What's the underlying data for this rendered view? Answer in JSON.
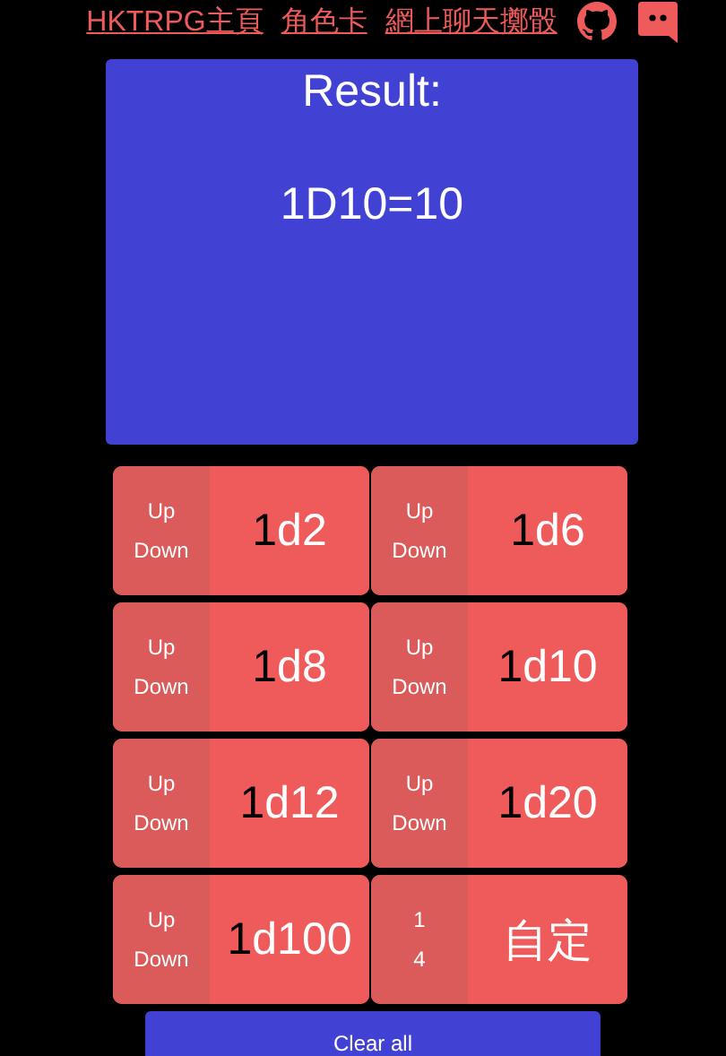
{
  "nav": {
    "links": [
      "HKTRPG主頁",
      "角色卡",
      "網上聊天擲骰"
    ]
  },
  "result": {
    "title": "Result:",
    "text": "1D10=10"
  },
  "dice": [
    {
      "kind": "updown",
      "up": "Up",
      "down": "Down",
      "count": "1",
      "die": "d2"
    },
    {
      "kind": "updown",
      "up": "Up",
      "down": "Down",
      "count": "1",
      "die": "d6"
    },
    {
      "kind": "updown",
      "up": "Up",
      "down": "Down",
      "count": "1",
      "die": "d8"
    },
    {
      "kind": "updown",
      "up": "Up",
      "down": "Down",
      "count": "1",
      "die": "d10"
    },
    {
      "kind": "updown",
      "up": "Up",
      "down": "Down",
      "count": "1",
      "die": "d12"
    },
    {
      "kind": "updown",
      "up": "Up",
      "down": "Down",
      "count": "1",
      "die": "d20"
    },
    {
      "kind": "updown",
      "up": "Up",
      "down": "Down",
      "count": "1",
      "die": "d100"
    },
    {
      "kind": "custom",
      "up": "1",
      "down": "4",
      "label": "自定"
    }
  ],
  "clear_button": "Clear all"
}
